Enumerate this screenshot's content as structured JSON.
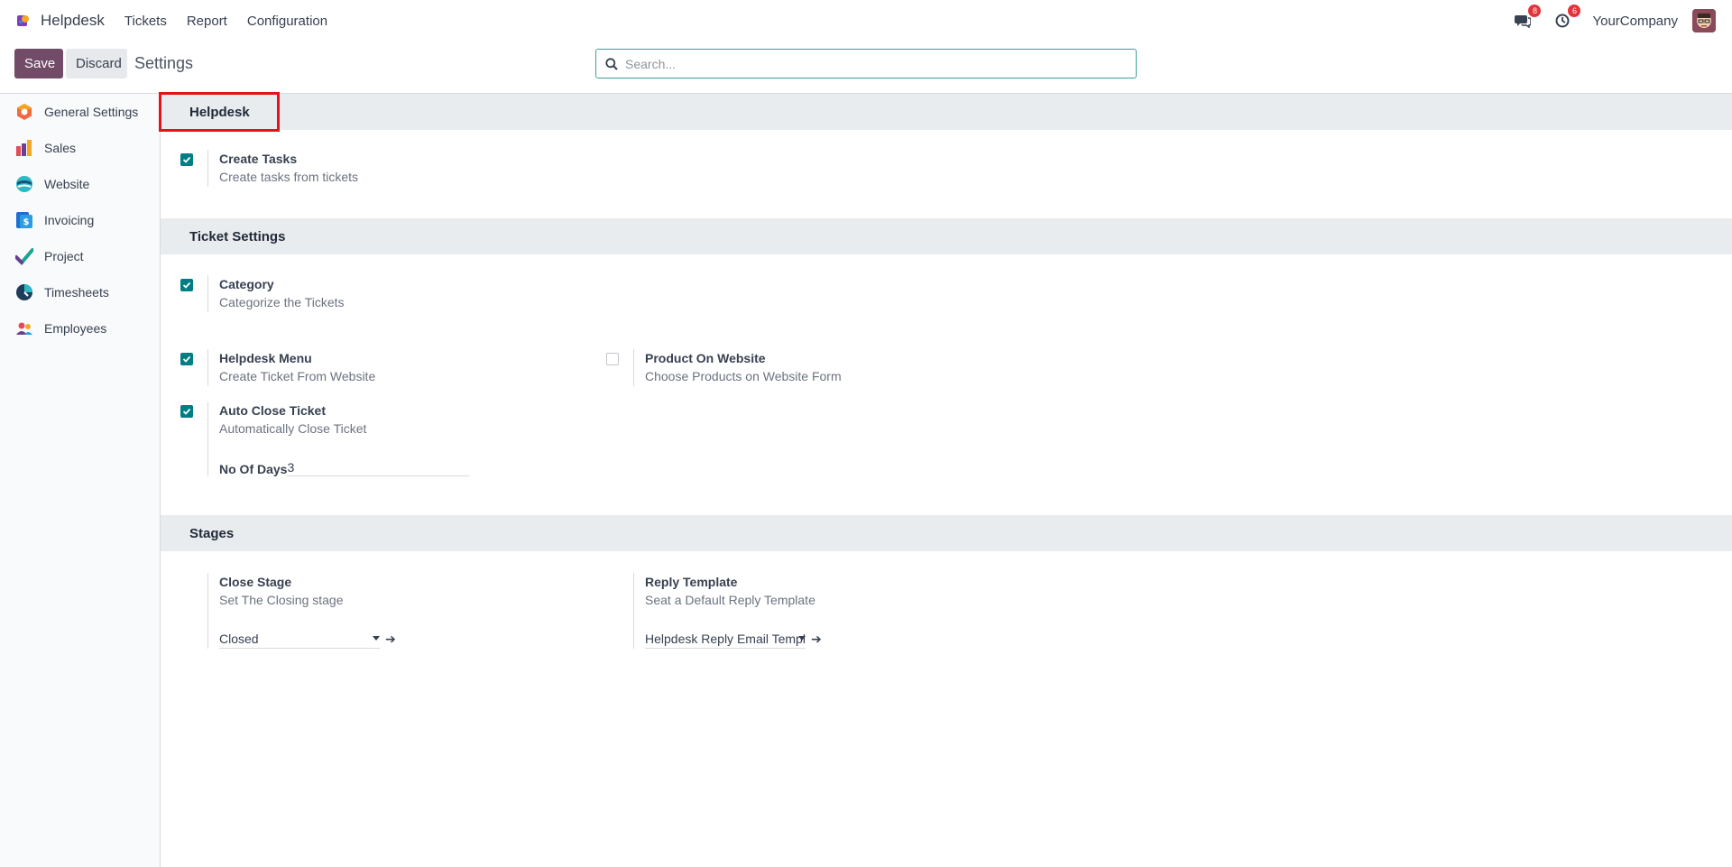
{
  "navbar": {
    "app_name": "Helpdesk",
    "menu": [
      "Tickets",
      "Report",
      "Configuration"
    ],
    "messages_count": "8",
    "activities_count": "6",
    "company": "YourCompany"
  },
  "control_panel": {
    "save_label": "Save",
    "discard_label": "Discard",
    "title": "Settings",
    "search_placeholder": "Search..."
  },
  "sidebar": {
    "items": [
      {
        "label": "General Settings",
        "icon": "settings-hex-icon"
      },
      {
        "label": "Sales",
        "icon": "sales-chart-icon"
      },
      {
        "label": "Website",
        "icon": "website-globe-icon"
      },
      {
        "label": "Invoicing",
        "icon": "invoice-dollar-icon"
      },
      {
        "label": "Project",
        "icon": "project-check-icon"
      },
      {
        "label": "Timesheets",
        "icon": "timesheets-clock-icon"
      },
      {
        "label": "Employees",
        "icon": "employees-people-icon"
      }
    ]
  },
  "sections": {
    "helpdesk": {
      "title": "Helpdesk",
      "create_tasks": {
        "title": "Create Tasks",
        "desc": "Create tasks from tickets",
        "checked": true
      }
    },
    "ticket_settings": {
      "title": "Ticket Settings",
      "category": {
        "title": "Category",
        "desc": "Categorize the Tickets",
        "checked": true
      },
      "helpdesk_menu": {
        "title": "Helpdesk Menu",
        "desc": "Create Ticket From Website",
        "checked": true
      },
      "product_on_website": {
        "title": "Product On Website",
        "desc": "Choose Products on Website Form",
        "checked": false
      },
      "auto_close": {
        "title": "Auto Close Ticket",
        "desc": "Automatically Close Ticket",
        "checked": true,
        "days_label": "No Of Days",
        "days_value": "3"
      }
    },
    "stages": {
      "title": "Stages",
      "close_stage": {
        "title": "Close Stage",
        "desc": "Set The Closing stage",
        "value": "Closed"
      },
      "reply_template": {
        "title": "Reply Template",
        "desc": "Seat a Default Reply Template",
        "value": "Helpdesk Reply Email Template"
      }
    }
  },
  "colors": {
    "brand": "#714b67",
    "accent": "#017e84",
    "badge": "#e3333b",
    "highlight": "#e3131b"
  }
}
